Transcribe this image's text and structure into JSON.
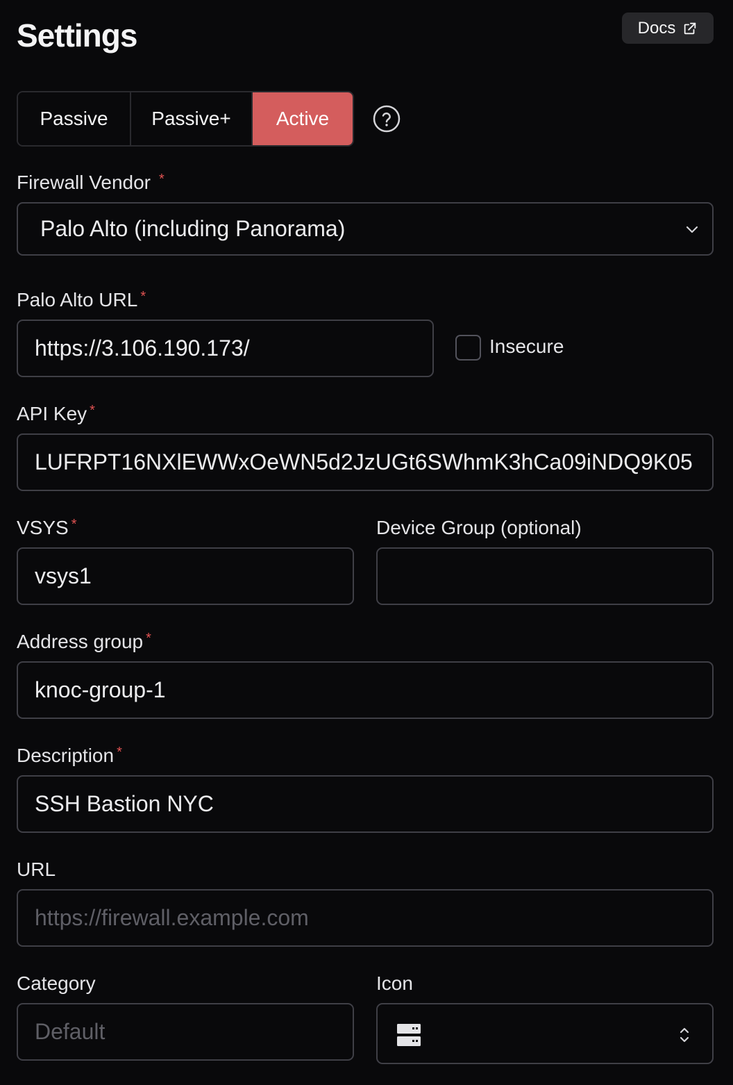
{
  "header": {
    "title": "Settings",
    "docs_label": "Docs"
  },
  "modes": {
    "items": [
      "Passive",
      "Passive+",
      "Active"
    ],
    "selected": "Active"
  },
  "colors": {
    "accent": "#d45d5d",
    "background": "#09090b",
    "required": "#e05252"
  },
  "vendor": {
    "label": "Firewall Vendor",
    "value": "Palo Alto (including Panorama)"
  },
  "url_field": {
    "label": "Palo Alto URL",
    "value": "https://3.106.190.173/"
  },
  "insecure": {
    "label": "Insecure",
    "checked": false
  },
  "api_key": {
    "label": "API Key",
    "value": "LUFRPT16NXlEWWxOeWN5d2JzUGt6SWhmK3hCa09iNDQ9K05"
  },
  "vsys": {
    "label": "VSYS",
    "value": "vsys1"
  },
  "device_group": {
    "label": "Device Group (optional)",
    "value": ""
  },
  "address_group": {
    "label": "Address group",
    "value": "knoc-group-1"
  },
  "description": {
    "label": "Description",
    "value": "SSH Bastion NYC"
  },
  "link_url": {
    "label": "URL",
    "placeholder": "https://firewall.example.com"
  },
  "category": {
    "label": "Category",
    "placeholder": "Default"
  },
  "icon": {
    "label": "Icon",
    "selected_icon": "server-icon"
  },
  "required_marker": "*"
}
